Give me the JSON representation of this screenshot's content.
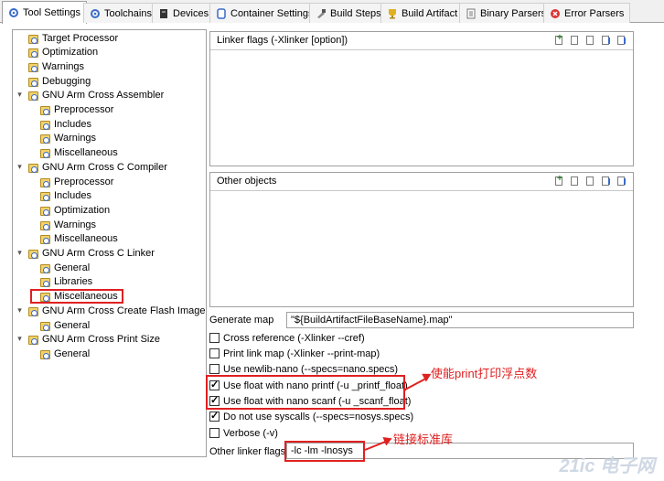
{
  "tabs": [
    {
      "label": "Tool Settings",
      "icon": "tool-settings-icon",
      "active": true
    },
    {
      "label": "Toolchains",
      "icon": "toolchains-icon"
    },
    {
      "label": "Devices",
      "icon": "devices-icon"
    },
    {
      "label": "Container Settings",
      "icon": "container-icon"
    },
    {
      "label": "Build Steps",
      "icon": "build-steps-icon"
    },
    {
      "label": "Build Artifact",
      "icon": "build-artifact-icon"
    },
    {
      "label": "Binary Parsers",
      "icon": "binary-parsers-icon"
    },
    {
      "label": "Error Parsers",
      "icon": "error-parsers-icon"
    }
  ],
  "tree": [
    {
      "label": "Target Processor"
    },
    {
      "label": "Optimization"
    },
    {
      "label": "Warnings"
    },
    {
      "label": "Debugging"
    },
    {
      "label": "GNU Arm Cross Assembler",
      "expanded": true
    },
    {
      "label": "Preprocessor"
    },
    {
      "label": "Includes"
    },
    {
      "label": "Warnings"
    },
    {
      "label": "Miscellaneous"
    },
    {
      "label": "GNU Arm Cross C Compiler",
      "expanded": true
    },
    {
      "label": "Preprocessor"
    },
    {
      "label": "Includes"
    },
    {
      "label": "Optimization"
    },
    {
      "label": "Warnings"
    },
    {
      "label": "Miscellaneous"
    },
    {
      "label": "GNU Arm Cross C Linker",
      "expanded": true
    },
    {
      "label": "General"
    },
    {
      "label": "Libraries"
    },
    {
      "label": "Miscellaneous",
      "selected": true
    },
    {
      "label": "GNU Arm Cross Create Flash Image",
      "expanded": true
    },
    {
      "label": "General"
    },
    {
      "label": "GNU Arm Cross Print Size",
      "expanded": true
    },
    {
      "label": "General"
    }
  ],
  "linker_flags_group": {
    "title": "Linker flags (-Xlinker [option])"
  },
  "other_objects_group": {
    "title": "Other objects"
  },
  "generate_map": {
    "label": "Generate map",
    "value": "\"${BuildArtifactFileBaseName}.map\""
  },
  "checkboxes": [
    {
      "label": "Cross reference (-Xlinker --cref)",
      "checked": false
    },
    {
      "label": "Print link map (-Xlinker --print-map)",
      "checked": false
    },
    {
      "label": "Use newlib-nano (--specs=nano.specs)",
      "checked": false
    },
    {
      "label": "Use float with nano printf (-u _printf_float)",
      "checked": true
    },
    {
      "label": "Use float with nano scanf (-u _scanf_float)",
      "checked": true
    },
    {
      "label": "Do not use syscalls (--specs=nosys.specs)",
      "checked": true
    },
    {
      "label": "Verbose (-v)",
      "checked": false
    }
  ],
  "other_linker_flags": {
    "label": "Other linker flags",
    "value": "-lc -lm -lnosys"
  },
  "annotations": {
    "float_note": "使能print打印浮点数",
    "lib_note": "链接标准库"
  },
  "watermark": "21ic 电子网",
  "colors": {
    "annotation": "#e02020",
    "border": "#a0a0a0"
  }
}
